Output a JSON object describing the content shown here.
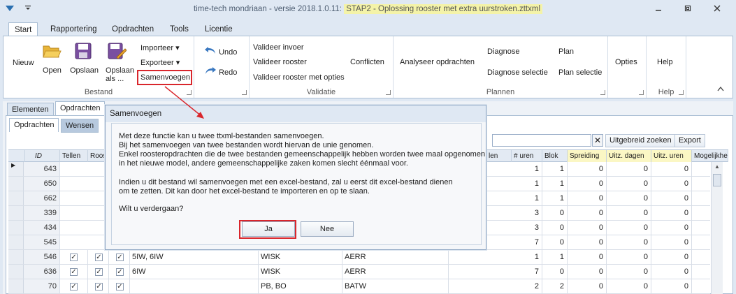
{
  "window": {
    "title_prefix": "time-tech mondriaan - versie 2018.1.0.11: ",
    "title_highlight": "STAP2 - Oplossing rooster met extra uurstroken.zttxml"
  },
  "ribbon": {
    "tabs": [
      "Start",
      "Rapportering",
      "Opdrachten",
      "Tools",
      "Licentie"
    ],
    "bestand": {
      "label": "Bestand",
      "nieuw": "Nieuw",
      "open": "Open",
      "opslaan": "Opslaan",
      "opslaan_als_1": "Opslaan",
      "opslaan_als_2": "als ...",
      "importeer": "Importeer",
      "exporteer": "Exporteer",
      "samenvoegen": "Samenvoegen"
    },
    "undo": {
      "undo": "Undo",
      "redo": "Redo"
    },
    "validatie": {
      "label": "Validatie",
      "invoer": "Valideer invoer",
      "rooster": "Valideer rooster",
      "opties": "Valideer rooster met opties",
      "conflicten": "Conflicten"
    },
    "plannen": {
      "label": "Plannen",
      "analyseer": "Analyseer opdrachten",
      "diagnose": "Diagnose",
      "diagnose_selectie": "Diagnose selectie",
      "plan": "Plan",
      "plan_selectie": "Plan selectie"
    },
    "opties": {
      "opties": "Opties"
    },
    "help": {
      "label": "Help",
      "help": "Help"
    }
  },
  "doc_tabs": [
    "Elementen",
    "Opdrachten"
  ],
  "sub_tabs": [
    "Opdrachten",
    "Wensen"
  ],
  "toolbar": {
    "clear": "✕",
    "uitgebreid": "Uitgebreid zoeken",
    "export": "Export"
  },
  "grid": {
    "columns": {
      "id": "ID",
      "tellen": "Tellen",
      "roos": "Roos",
      "len": "len",
      "uren": "# uren",
      "blok": "Blok",
      "spreiding": "Spreiding",
      "dagen": "Uitz. dagen",
      "uitzuren": "Uitz. uren",
      "mogelijk": "Mogelijkhe"
    },
    "rows": [
      {
        "id": "643",
        "c1": "",
        "c2": "",
        "c3": "",
        "uren": "1",
        "blok": "1",
        "s": "0",
        "d": "0",
        "u": "0",
        "meter": "red"
      },
      {
        "id": "650",
        "c1": "",
        "c2": "",
        "c3": "",
        "uren": "1",
        "blok": "1",
        "s": "0",
        "d": "0",
        "u": "0",
        "meter": "red"
      },
      {
        "id": "662",
        "c1": "",
        "c2": "",
        "c3": "",
        "uren": "1",
        "blok": "1",
        "s": "0",
        "d": "0",
        "u": "0",
        "meter": "red"
      },
      {
        "id": "339",
        "c1": "",
        "c2": "",
        "c3": "",
        "uren": "3",
        "blok": "0",
        "s": "0",
        "d": "0",
        "u": "0",
        "meter": "striped"
      },
      {
        "id": "434",
        "c1": "",
        "c2": "",
        "c3": "",
        "uren": "3",
        "blok": "0",
        "s": "0",
        "d": "0",
        "u": "0",
        "meter": "striped"
      },
      {
        "id": "545",
        "c1": "",
        "c2": "",
        "c3": "",
        "uren": "7",
        "blok": "0",
        "s": "0",
        "d": "0",
        "u": "0",
        "meter": "striped"
      },
      {
        "id": "546",
        "c1": "5IW, 6IW",
        "c2": "WISK",
        "c3": "AERR",
        "uren": "1",
        "blok": "1",
        "s": "0",
        "d": "0",
        "u": "0",
        "meter": "red"
      },
      {
        "id": "636",
        "c1": "6IW",
        "c2": "WISK",
        "c3": "AERR",
        "uren": "7",
        "blok": "0",
        "s": "0",
        "d": "0",
        "u": "0",
        "meter": "striped"
      },
      {
        "id": "70",
        "c1": "",
        "c2": "PB, BO",
        "c3": "BATW",
        "uren": "2",
        "blok": "2",
        "s": "0",
        "d": "0",
        "u": "0",
        "meter": "dark"
      }
    ]
  },
  "dialog": {
    "title": "Samenvoegen",
    "lines": [
      "Met deze functie kan u twee ttxml-bestanden samenvoegen.",
      "Bij het samenvoegen van twee bestanden wordt hiervan de unie genomen.",
      "Enkel roosteropdrachten die de twee bestanden gemeenschappelijk hebben worden twee maal opgenomen",
      "in het nieuwe model, andere gemeenschappelijke zaken komen slecht éénmaal voor.",
      "Indien u dit bestand wil samenvoegen met een excel-bestand, zal u eerst dit excel-bestand dienen",
      "om te zetten. Dit kan door het excel-bestand te importeren en op te slaan.",
      "Wilt u verdergaan?"
    ],
    "ja": "Ja",
    "nee": "Nee"
  },
  "colors": {
    "highlight": "#d9262c",
    "accent": "#1f5fa8"
  }
}
